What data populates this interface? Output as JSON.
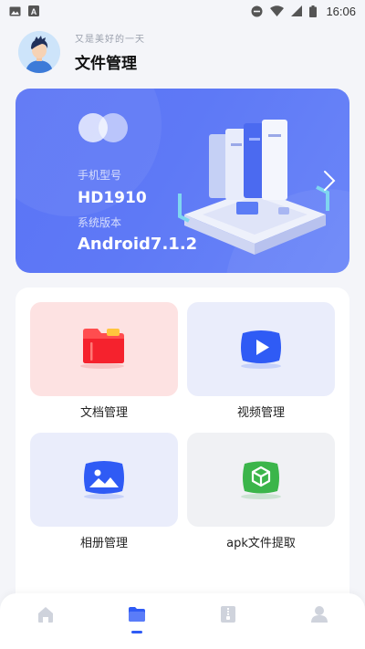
{
  "status_bar": {
    "time": "16:06",
    "left_icons": [
      "image-icon",
      "a-notification-icon"
    ],
    "right_icons": [
      "do-not-disturb-icon",
      "wifi-icon",
      "signal-icon",
      "battery-icon"
    ]
  },
  "header": {
    "greeting": "又是美好的一天",
    "title": "文件管理",
    "avatar_icon": "user-avatar-icon"
  },
  "device_card": {
    "model_label": "手机型号",
    "model_value": "HD1910",
    "os_label": "系统版本",
    "os_value": "Android7.1.2",
    "colors": {
      "background": "#5b74f5"
    }
  },
  "tools": [
    {
      "label": "文档管理",
      "icon": "folder-icon",
      "bg": "#fde2e2"
    },
    {
      "label": "视频管理",
      "icon": "video-play-icon",
      "bg": "#eaedfb"
    },
    {
      "label": "相册管理",
      "icon": "image-gallery-icon",
      "bg": "#eaedfb"
    },
    {
      "label": "apk文件提取",
      "icon": "apk-cube-icon",
      "bg": "#f0f1f4"
    }
  ],
  "bottom_nav": {
    "items": [
      {
        "icon": "home-icon",
        "active": false
      },
      {
        "icon": "folder-icon",
        "active": true
      },
      {
        "icon": "zip-file-icon",
        "active": false
      },
      {
        "icon": "profile-icon",
        "active": false
      }
    ],
    "active_color": "#2f5bf5",
    "inactive_color": "#cfd3dc"
  }
}
